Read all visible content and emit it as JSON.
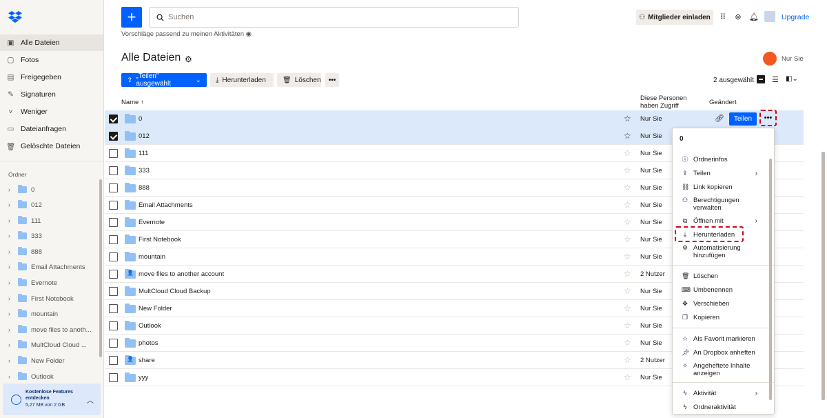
{
  "sidebar": {
    "nav": [
      {
        "label": "Alle Dateien",
        "icon": "files-icon",
        "active": true
      },
      {
        "label": "Fotos",
        "icon": "photo-icon"
      },
      {
        "label": "Freigegeben",
        "icon": "share-icon"
      },
      {
        "label": "Signaturen",
        "icon": "signature-icon"
      },
      {
        "label": "Weniger",
        "icon": "chevron-up-icon"
      },
      {
        "label": "Dateianfragen",
        "icon": "file-request-icon"
      },
      {
        "label": "Gelöschte Dateien",
        "icon": "trash-icon"
      }
    ],
    "folders_title": "Ordner",
    "folders": [
      "0",
      "012",
      "111",
      "333",
      "888",
      "Email Attachments",
      "Evernote",
      "First Notebook",
      "mountain",
      "move files to anoth...",
      "MultCloud Cloud ...",
      "New Folder",
      "Outlook"
    ],
    "promo": {
      "title": "Kostenlose Features entdecken",
      "usage": "5,27 MB von 2 GB"
    }
  },
  "topbar": {
    "search_placeholder": "Suchen",
    "invite_label": "Mitglieder einladen",
    "upgrade_label": "Upgrade"
  },
  "main": {
    "hint": "Vorschläge passend zu meinen Aktivitäten",
    "title": "Alle Dateien",
    "avatar_label": "Nur Sie",
    "toolbar": {
      "share_label": "„Teilen\" ausgewählt",
      "download_label": "Herunterladen",
      "delete_label": "Löschen",
      "selected_count": "2 ausgewählt"
    },
    "columns": {
      "name": "Name",
      "access": "Diese Personen haben Zugriff",
      "modified": "Geändert"
    },
    "rows": [
      {
        "name": "0",
        "access": "Nur Sie",
        "selected": true,
        "shared": false
      },
      {
        "name": "012",
        "access": "Nur Sie",
        "selected": true,
        "shared": false
      },
      {
        "name": "111",
        "access": "Nur Sie"
      },
      {
        "name": "333",
        "access": "Nur Sie"
      },
      {
        "name": "888",
        "access": "Nur Sie"
      },
      {
        "name": "Email Attachments",
        "access": "Nur Sie"
      },
      {
        "name": "Evernote",
        "access": "Nur Sie"
      },
      {
        "name": "First Notebook",
        "access": "Nur Sie"
      },
      {
        "name": "mountain",
        "access": "Nur Sie"
      },
      {
        "name": "move files to another account",
        "access": "2 Nutzer",
        "shared": true
      },
      {
        "name": "MultCloud Cloud Backup",
        "access": "Nur Sie"
      },
      {
        "name": "New Folder",
        "access": "Nur Sie"
      },
      {
        "name": "Outlook",
        "access": "Nur Sie"
      },
      {
        "name": "photos",
        "access": "Nur Sie"
      },
      {
        "name": "share",
        "access": "2 Nutzer",
        "shared": true
      },
      {
        "name": "yyy",
        "access": "Nur Sie"
      }
    ],
    "row_share_label": "Teilen"
  },
  "menu": {
    "header": "0",
    "groups": [
      [
        {
          "label": "Ordnerinfos",
          "icon": "info-icon"
        },
        {
          "label": "Teilen",
          "icon": "share-icon",
          "submenu": true
        },
        {
          "label": "Link kopieren",
          "icon": "link-icon"
        },
        {
          "label": "Berechtigungen verwalten",
          "icon": "permissions-icon"
        },
        {
          "label": "Öffnen mit",
          "icon": "open-with-icon",
          "submenu": true
        },
        {
          "label": "Herunterladen",
          "icon": "download-icon",
          "highlight": true
        },
        {
          "label": "Automatisierung hinzufügen",
          "icon": "automation-icon"
        }
      ],
      [
        {
          "label": "Löschen",
          "icon": "trash-icon"
        },
        {
          "label": "Umbenennen",
          "icon": "rename-icon"
        },
        {
          "label": "Verschieben",
          "icon": "move-icon"
        },
        {
          "label": "Kopieren",
          "icon": "copy-icon"
        }
      ],
      [
        {
          "label": "Als Favorit markieren",
          "icon": "star-icon"
        },
        {
          "label": "An Dropbox anheften",
          "icon": "pin-icon"
        },
        {
          "label": "Angeheftete Inhalte anzeigen",
          "icon": "pin-view-icon"
        }
      ],
      [
        {
          "label": "Aktivität",
          "icon": "activity-icon",
          "submenu": true
        },
        {
          "label": "Ordneraktivität",
          "icon": "folder-activity-icon"
        }
      ]
    ]
  },
  "colors": {
    "accent": "#0061fe",
    "selected_row": "#dce9fb",
    "highlight": "#d0021b"
  }
}
